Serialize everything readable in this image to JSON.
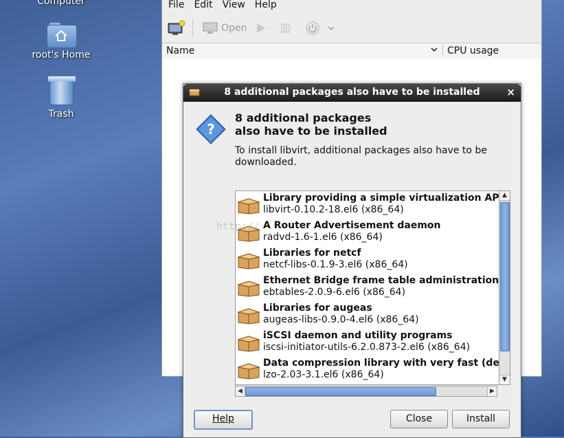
{
  "desktop": {
    "computer_label": "Computer",
    "home_label": "root's Home",
    "trash_label": "Trash"
  },
  "app": {
    "menu": [
      "File",
      "Edit",
      "View",
      "Help"
    ],
    "toolbar": {
      "open_label": "Open"
    },
    "columns": {
      "name": "Name",
      "cpu": "CPU usage"
    }
  },
  "dialog": {
    "title": "8 additional packages also have to be installed",
    "heading_line1": "8 additional packages",
    "heading_line2": "also have to be installed",
    "description": "To install libvirt, additional packages also have to be downloaded.",
    "packages": [
      {
        "title": "Library providing a simple virtualization AP",
        "version": "libvirt-0.10.2-18.el6 (x86_64)"
      },
      {
        "title": "A Router Advertisement daemon",
        "version": "radvd-1.6-1.el6 (x86_64)"
      },
      {
        "title": "Libraries for netcf",
        "version": "netcf-libs-0.1.9-3.el6 (x86_64)"
      },
      {
        "title": "Ethernet Bridge frame table administration t",
        "version": "ebtables-2.0.9-6.el6 (x86_64)"
      },
      {
        "title": "Libraries for augeas",
        "version": "augeas-libs-0.9.0-4.el6 (x86_64)"
      },
      {
        "title": "iSCSI daemon and utility programs",
        "version": "iscsi-initiator-utils-6.2.0.873-2.el6 (x86_64)"
      },
      {
        "title": "Data compression library with very fast (de)",
        "version": "lzo-2.03-3.1.el6 (x86_64)"
      }
    ],
    "buttons": {
      "help": "Help",
      "close": "Close",
      "install": "Install"
    }
  },
  "watermark": "http://"
}
